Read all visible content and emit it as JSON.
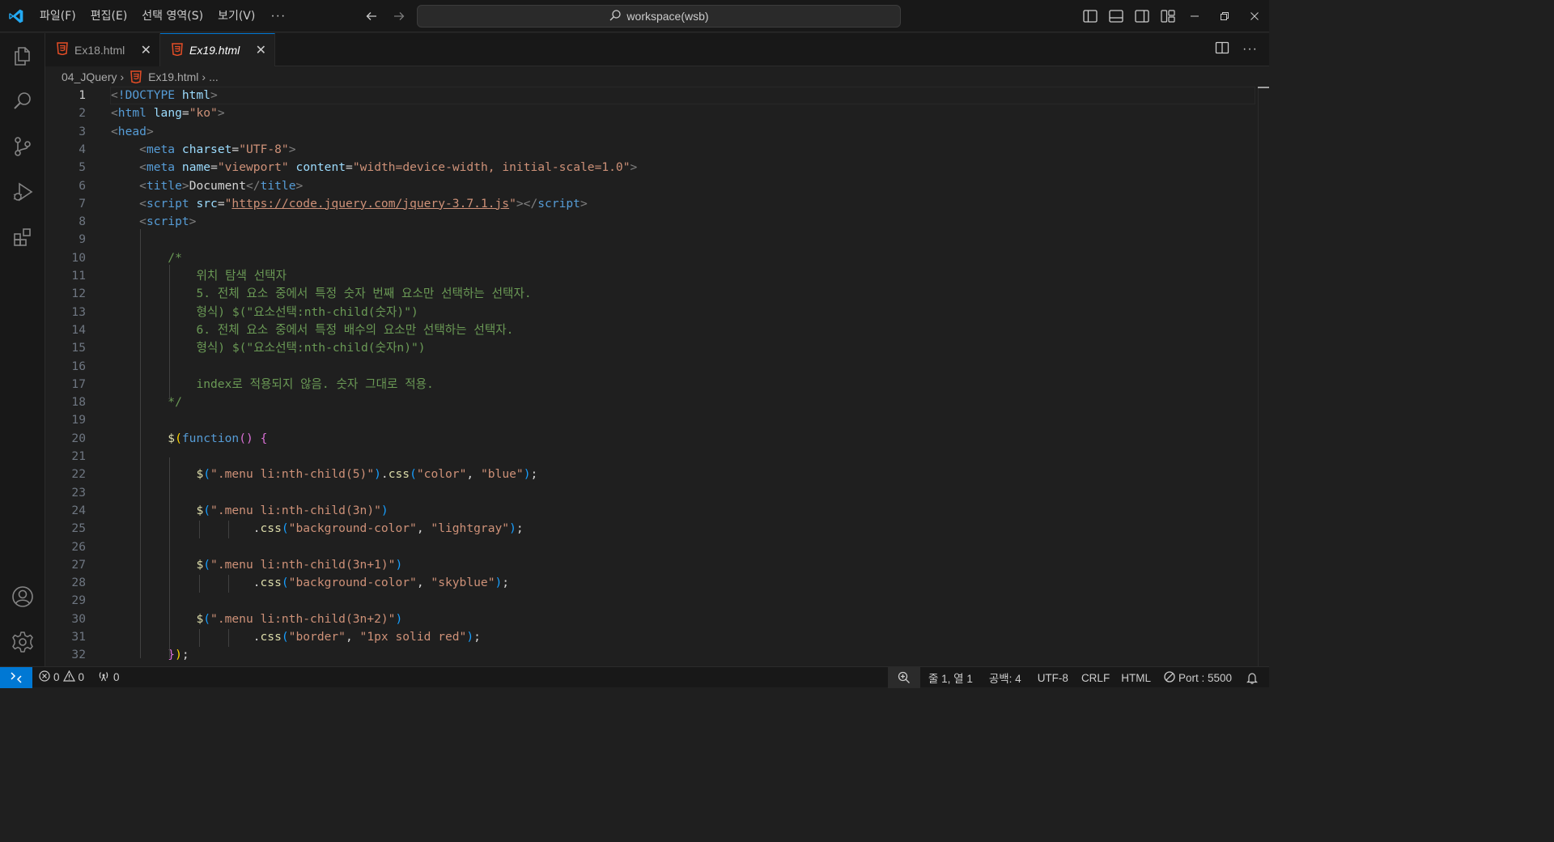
{
  "titlebar": {
    "menu": [
      "파일(F)",
      "편집(E)",
      "선택 영역(S)",
      "보기(V)"
    ],
    "more": "···",
    "search_text": "workspace(wsb)"
  },
  "tabs": [
    {
      "label": "Ex18.html",
      "active": false
    },
    {
      "label": "Ex19.html",
      "active": true
    }
  ],
  "breadcrumb": {
    "folder": "04_JQuery",
    "file": "Ex19.html",
    "more": "..."
  },
  "editor": {
    "active_line": 1,
    "lines": [
      [
        [
          "t-punc",
          "<"
        ],
        [
          "t-tag",
          "!DOCTYPE"
        ],
        [
          "t-text",
          " "
        ],
        [
          "t-attr",
          "html"
        ],
        [
          "t-punc",
          ">"
        ]
      ],
      [
        [
          "t-punc",
          "<"
        ],
        [
          "t-tag",
          "html"
        ],
        [
          "t-text",
          " "
        ],
        [
          "t-attr",
          "lang"
        ],
        [
          "t-text",
          "="
        ],
        [
          "t-str",
          "\"ko\""
        ],
        [
          "t-punc",
          ">"
        ]
      ],
      [
        [
          "t-punc",
          "<"
        ],
        [
          "t-tag",
          "head"
        ],
        [
          "t-punc",
          ">"
        ]
      ],
      [
        [
          "t-text",
          "    "
        ],
        [
          "t-punc",
          "<"
        ],
        [
          "t-tag",
          "meta"
        ],
        [
          "t-text",
          " "
        ],
        [
          "t-attr",
          "charset"
        ],
        [
          "t-text",
          "="
        ],
        [
          "t-str",
          "\"UTF-8\""
        ],
        [
          "t-punc",
          ">"
        ]
      ],
      [
        [
          "t-text",
          "    "
        ],
        [
          "t-punc",
          "<"
        ],
        [
          "t-tag",
          "meta"
        ],
        [
          "t-text",
          " "
        ],
        [
          "t-attr",
          "name"
        ],
        [
          "t-text",
          "="
        ],
        [
          "t-str",
          "\"viewport\""
        ],
        [
          "t-text",
          " "
        ],
        [
          "t-attr",
          "content"
        ],
        [
          "t-text",
          "="
        ],
        [
          "t-str",
          "\"width=device-width, initial-scale=1.0\""
        ],
        [
          "t-punc",
          ">"
        ]
      ],
      [
        [
          "t-text",
          "    "
        ],
        [
          "t-punc",
          "<"
        ],
        [
          "t-tag",
          "title"
        ],
        [
          "t-punc",
          ">"
        ],
        [
          "t-text",
          "Document"
        ],
        [
          "t-punc",
          "</"
        ],
        [
          "t-tag",
          "title"
        ],
        [
          "t-punc",
          ">"
        ]
      ],
      [
        [
          "t-text",
          "    "
        ],
        [
          "t-punc",
          "<"
        ],
        [
          "t-tag",
          "script"
        ],
        [
          "t-text",
          " "
        ],
        [
          "t-attr",
          "src"
        ],
        [
          "t-text",
          "="
        ],
        [
          "t-str",
          "\""
        ],
        [
          "t-url",
          "https://code.jquery.com/jquery-3.7.1.js"
        ],
        [
          "t-str",
          "\""
        ],
        [
          "t-punc",
          "></"
        ],
        [
          "t-tag",
          "script"
        ],
        [
          "t-punc",
          ">"
        ]
      ],
      [
        [
          "t-text",
          "    "
        ],
        [
          "t-punc",
          "<"
        ],
        [
          "t-tag",
          "script"
        ],
        [
          "t-punc",
          ">"
        ]
      ],
      [],
      [
        [
          "t-text",
          "        "
        ],
        [
          "t-cmt",
          "/*"
        ]
      ],
      [
        [
          "t-text",
          "            "
        ],
        [
          "t-cmt",
          "위치 탐색 선택자"
        ]
      ],
      [
        [
          "t-text",
          "            "
        ],
        [
          "t-cmt",
          "5. 전체 요소 중에서 특정 숫자 번째 요소만 선택하는 선택자."
        ]
      ],
      [
        [
          "t-text",
          "            "
        ],
        [
          "t-cmt",
          "형식) $(\"요소선택:nth-child(숫자)\")"
        ]
      ],
      [
        [
          "t-text",
          "            "
        ],
        [
          "t-cmt",
          "6. 전체 요소 중에서 특정 배수의 요소만 선택하는 선택자."
        ]
      ],
      [
        [
          "t-text",
          "            "
        ],
        [
          "t-cmt",
          "형식) $(\"요소선택:nth-child(숫자n)\")"
        ]
      ],
      [],
      [
        [
          "t-text",
          "            "
        ],
        [
          "t-cmt",
          "index로 적용되지 않음. 숫자 그대로 적용."
        ]
      ],
      [
        [
          "t-text",
          "        "
        ],
        [
          "t-cmt",
          "*/"
        ]
      ],
      [],
      [
        [
          "t-text",
          "        "
        ],
        [
          "t-fn",
          "$"
        ],
        [
          "t-b1",
          "("
        ],
        [
          "t-kw",
          "function"
        ],
        [
          "t-b2",
          "()"
        ],
        [
          "t-text",
          " "
        ],
        [
          "t-b2",
          "{"
        ]
      ],
      [],
      [
        [
          "t-text",
          "            "
        ],
        [
          "t-fn",
          "$"
        ],
        [
          "t-b3",
          "("
        ],
        [
          "t-str",
          "\".menu li:nth-child(5)\""
        ],
        [
          "t-b3",
          ")"
        ],
        [
          "t-text",
          "."
        ],
        [
          "t-fn",
          "css"
        ],
        [
          "t-b3",
          "("
        ],
        [
          "t-str",
          "\"color\""
        ],
        [
          "t-text",
          ", "
        ],
        [
          "t-str",
          "\"blue\""
        ],
        [
          "t-b3",
          ")"
        ],
        [
          "t-text",
          ";"
        ]
      ],
      [],
      [
        [
          "t-text",
          "            "
        ],
        [
          "t-fn",
          "$"
        ],
        [
          "t-b3",
          "("
        ],
        [
          "t-str",
          "\".menu li:nth-child(3n)\""
        ],
        [
          "t-b3",
          ")"
        ]
      ],
      [
        [
          "t-text",
          "                    ."
        ],
        [
          "t-fn",
          "css"
        ],
        [
          "t-b3",
          "("
        ],
        [
          "t-str",
          "\"background-color\""
        ],
        [
          "t-text",
          ", "
        ],
        [
          "t-str",
          "\"lightgray\""
        ],
        [
          "t-b3",
          ")"
        ],
        [
          "t-text",
          ";"
        ]
      ],
      [],
      [
        [
          "t-text",
          "            "
        ],
        [
          "t-fn",
          "$"
        ],
        [
          "t-b3",
          "("
        ],
        [
          "t-str",
          "\".menu li:nth-child(3n+1)\""
        ],
        [
          "t-b3",
          ")"
        ]
      ],
      [
        [
          "t-text",
          "                    ."
        ],
        [
          "t-fn",
          "css"
        ],
        [
          "t-b3",
          "("
        ],
        [
          "t-str",
          "\"background-color\""
        ],
        [
          "t-text",
          ", "
        ],
        [
          "t-str",
          "\"skyblue\""
        ],
        [
          "t-b3",
          ")"
        ],
        [
          "t-text",
          ";"
        ]
      ],
      [],
      [
        [
          "t-text",
          "            "
        ],
        [
          "t-fn",
          "$"
        ],
        [
          "t-b3",
          "("
        ],
        [
          "t-str",
          "\".menu li:nth-child(3n+2)\""
        ],
        [
          "t-b3",
          ")"
        ]
      ],
      [
        [
          "t-text",
          "                    ."
        ],
        [
          "t-fn",
          "css"
        ],
        [
          "t-b3",
          "("
        ],
        [
          "t-str",
          "\"border\""
        ],
        [
          "t-text",
          ", "
        ],
        [
          "t-str",
          "\"1px solid red\""
        ],
        [
          "t-b3",
          ")"
        ],
        [
          "t-text",
          ";"
        ]
      ],
      [
        [
          "t-text",
          "        "
        ],
        [
          "t-b2",
          "}"
        ],
        [
          "t-b1",
          ")"
        ],
        [
          "t-text",
          ";"
        ]
      ]
    ]
  },
  "statusbar": {
    "errors": "0",
    "warnings": "0",
    "ports": "0",
    "position": "줄 1, 열 1",
    "spaces": "공백: 4",
    "encoding": "UTF-8",
    "eol": "CRLF",
    "language": "HTML",
    "port": "Port : 5500"
  },
  "colors": {
    "accent": "#0078d4",
    "html_icon": "#e44d26",
    "vscode_logo": "#23a9f2"
  }
}
